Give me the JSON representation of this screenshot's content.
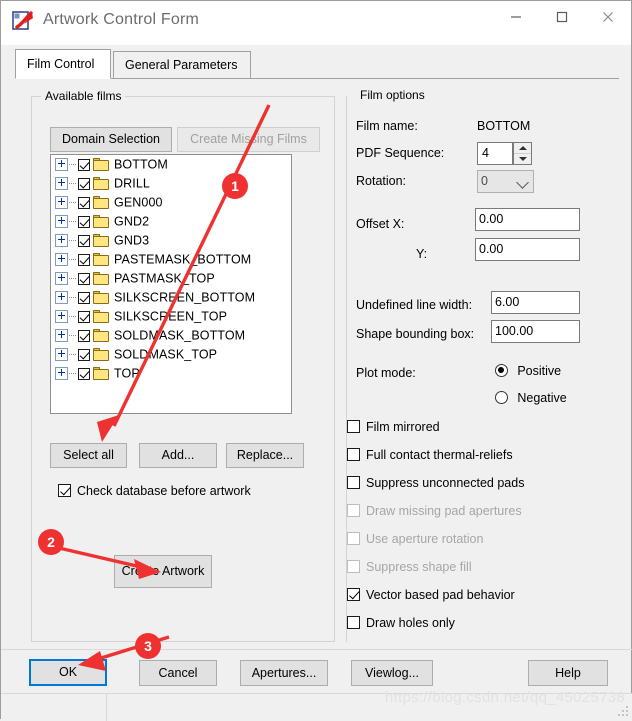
{
  "window": {
    "title": "Artwork Control Form",
    "icon": "artwork-app-icon",
    "controls": {
      "minimize": "minimize-icon",
      "maximize": "maximize-icon",
      "close": "close-icon"
    }
  },
  "tabs": [
    {
      "label": "Film Control",
      "active": true
    },
    {
      "label": "General Parameters",
      "active": false
    }
  ],
  "available_films": {
    "group_label": "Available films",
    "buttons": {
      "domain_selection": "Domain Selection",
      "create_missing_films": "Create Missing Films",
      "select_all": "Select all",
      "add": "Add...",
      "replace": "Replace...",
      "create_artwork": "Create Artwork"
    },
    "films": [
      "BOTTOM",
      "DRILL",
      "GEN000",
      "GND2",
      "GND3",
      "PASTEMASK_BOTTOM",
      "PASTMASK_TOP",
      "SILKSCREEN_BOTTOM",
      "SILKSCREEN_TOP",
      "SOLDMASK_BOTTOM",
      "SOLDMASK_TOP",
      "TOP"
    ],
    "check_database": {
      "label": "Check database before artwork",
      "checked": true
    }
  },
  "film_options": {
    "group_label": "Film options",
    "film_name_label": "Film name:",
    "film_name_value": "BOTTOM",
    "pdf_sequence_label": "PDF Sequence:",
    "pdf_sequence_value": "4",
    "rotation_label": "Rotation:",
    "rotation_value": "0",
    "offset_x_label": "Offset  X:",
    "offset_x_value": "0.00",
    "offset_y_label": "Y:",
    "offset_y_value": "0.00",
    "undefined_line_width_label": "Undefined line width:",
    "undefined_line_width_value": "6.00",
    "shape_bounding_box_label": "Shape bounding box:",
    "shape_bounding_box_value": "100.00",
    "plot_mode_label": "Plot mode:",
    "plot_mode_options": [
      {
        "label": "Positive",
        "selected": true
      },
      {
        "label": "Negative",
        "selected": false
      }
    ],
    "checkboxes": [
      {
        "label": "Film mirrored",
        "checked": false,
        "enabled": true
      },
      {
        "label": "Full contact thermal-reliefs",
        "checked": false,
        "enabled": true
      },
      {
        "label": "Suppress unconnected pads",
        "checked": false,
        "enabled": true
      },
      {
        "label": "Draw missing pad apertures",
        "checked": false,
        "enabled": false
      },
      {
        "label": "Use aperture rotation",
        "checked": false,
        "enabled": false
      },
      {
        "label": "Suppress shape fill",
        "checked": false,
        "enabled": false
      },
      {
        "label": "Vector based pad behavior",
        "checked": true,
        "enabled": true
      },
      {
        "label": "Draw holes only",
        "checked": false,
        "enabled": true
      }
    ]
  },
  "footer": {
    "ok": "OK",
    "cancel": "Cancel",
    "apertures": "Apertures...",
    "viewlog": "Viewlog...",
    "help": "Help"
  },
  "watermark": "https://blog.csdn.net/qq_45025738",
  "annotations": [
    {
      "number": "1"
    },
    {
      "number": "2"
    },
    {
      "number": "3"
    }
  ],
  "colors": {
    "accent": "#0078d7",
    "annotation": "#ef3131",
    "folder": "#ffe680"
  }
}
